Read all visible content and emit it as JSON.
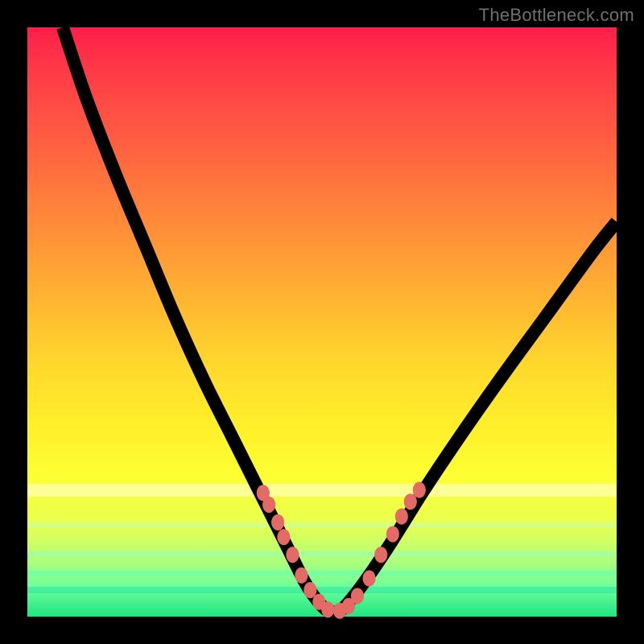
{
  "attribution": "TheBottleneck.com",
  "bg_gradient_stops": [
    {
      "pct": 0,
      "color": "#ff1e48"
    },
    {
      "pct": 8,
      "color": "#ff3c47"
    },
    {
      "pct": 18,
      "color": "#ff5a42"
    },
    {
      "pct": 28,
      "color": "#ff7a3c"
    },
    {
      "pct": 38,
      "color": "#ff9a36"
    },
    {
      "pct": 48,
      "color": "#ffbb30"
    },
    {
      "pct": 58,
      "color": "#ffda2c"
    },
    {
      "pct": 68,
      "color": "#fff02a"
    },
    {
      "pct": 76,
      "color": "#feff33"
    },
    {
      "pct": 84,
      "color": "#e9ff4e"
    },
    {
      "pct": 90,
      "color": "#b6ff76"
    },
    {
      "pct": 95,
      "color": "#6dff9b"
    },
    {
      "pct": 100,
      "color": "#20e57e"
    }
  ],
  "chart_data": {
    "type": "line",
    "title": "",
    "xlabel": "",
    "ylabel": "",
    "xlim": [
      0,
      100
    ],
    "ylim": [
      0,
      100
    ],
    "grid": false,
    "notes": "V-shaped bottleneck curve; y read as percent height from top (0) to bottom (100).",
    "series": [
      {
        "name": "bottleneck-curve",
        "x": [
          6,
          10,
          15,
          20,
          25,
          30,
          35,
          40,
          44,
          47,
          49,
          51,
          53,
          55,
          58,
          62,
          67,
          73,
          80,
          88,
          96,
          100
        ],
        "y": [
          0,
          12,
          25,
          37,
          49,
          60,
          70,
          80,
          88,
          94,
          97,
          99,
          99,
          97,
          93,
          87,
          79,
          70,
          60,
          49,
          38,
          33
        ]
      }
    ],
    "highlight_beads": {
      "color": "#e46a66",
      "points": [
        {
          "x": 40,
          "y": 79
        },
        {
          "x": 41,
          "y": 81
        },
        {
          "x": 42.5,
          "y": 84
        },
        {
          "x": 43.5,
          "y": 86.5
        },
        {
          "x": 45,
          "y": 89.5
        },
        {
          "x": 46.5,
          "y": 93
        },
        {
          "x": 48,
          "y": 95.5
        },
        {
          "x": 49.5,
          "y": 97.5
        },
        {
          "x": 51,
          "y": 98.8
        },
        {
          "x": 53,
          "y": 99
        },
        {
          "x": 54.5,
          "y": 98.2
        },
        {
          "x": 56,
          "y": 96.5
        },
        {
          "x": 58,
          "y": 93.5
        },
        {
          "x": 60,
          "y": 89.5
        },
        {
          "x": 62,
          "y": 86
        },
        {
          "x": 63.5,
          "y": 83
        },
        {
          "x": 65,
          "y": 80.5
        },
        {
          "x": 66.5,
          "y": 78.5
        }
      ]
    },
    "lower_bands": [
      {
        "top_pct": 77.5,
        "height_pct": 2.2,
        "color": "rgba(255,255,220,0.55)"
      },
      {
        "top_pct": 84.0,
        "height_pct": 1.0,
        "color": "rgba(190,255,190,0.45)"
      },
      {
        "top_pct": 89.0,
        "height_pct": 0.9,
        "color": "rgba(140,255,200,0.45)"
      },
      {
        "top_pct": 92.2,
        "height_pct": 0.9,
        "color": "rgba(90,255,190,0.45)"
      },
      {
        "top_pct": 95.0,
        "height_pct": 1.1,
        "color": "rgba(40,230,160,0.55)"
      }
    ]
  }
}
